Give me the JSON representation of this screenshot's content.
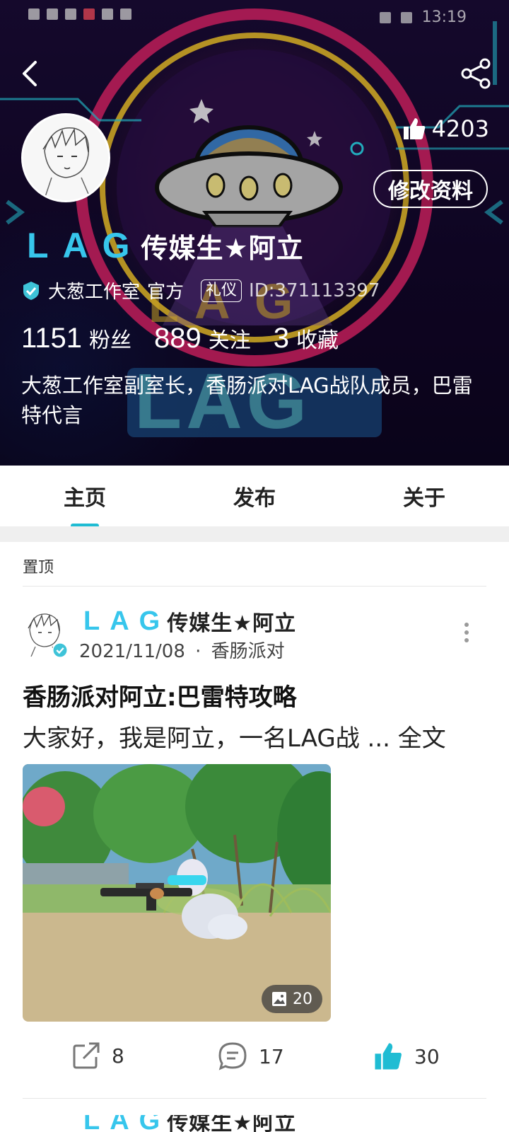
{
  "status_bar": {
    "time": "13:19"
  },
  "profile": {
    "logo_text": "LAG",
    "display_name": "传媒生★阿立",
    "org_name": "大葱工作室",
    "org_role": "官方",
    "tag": "礼仪",
    "user_id": "ID:371113397",
    "likes": "4203",
    "edit_label": "修改资料",
    "stats": [
      {
        "value": "1151",
        "label": "粉丝"
      },
      {
        "value": "889",
        "label": "关注"
      },
      {
        "value": "3",
        "label": "收藏"
      }
    ],
    "bio": "大葱工作室副室长，香肠派对LAG战队成员，巴雷特代言"
  },
  "tabs": [
    {
      "label": "主页",
      "active": true
    },
    {
      "label": "发布",
      "active": false
    },
    {
      "label": "关于",
      "active": false
    }
  ],
  "pinned_label": "置顶",
  "post": {
    "author_logo": "LAG",
    "author_name": "传媒生★阿立",
    "date": "2021/11/08",
    "category": "香肠派对",
    "meta_sep": "·",
    "title": "香肠派对阿立:巴雷特攻略",
    "excerpt": "大家好，我是阿立，一名LAG战 ... 全文",
    "image_count": "20",
    "shares": "8",
    "comments": "17",
    "likes": "30"
  },
  "colors": {
    "accent": "#1fbcd3",
    "lag_blue": "#37c6ec"
  },
  "icons": [
    "back-arrow-icon",
    "share-icon",
    "thumbs-up-icon",
    "verified-badge-icon",
    "more-vertical-icon",
    "image-icon",
    "share-external-icon",
    "comment-icon",
    "like-icon"
  ]
}
